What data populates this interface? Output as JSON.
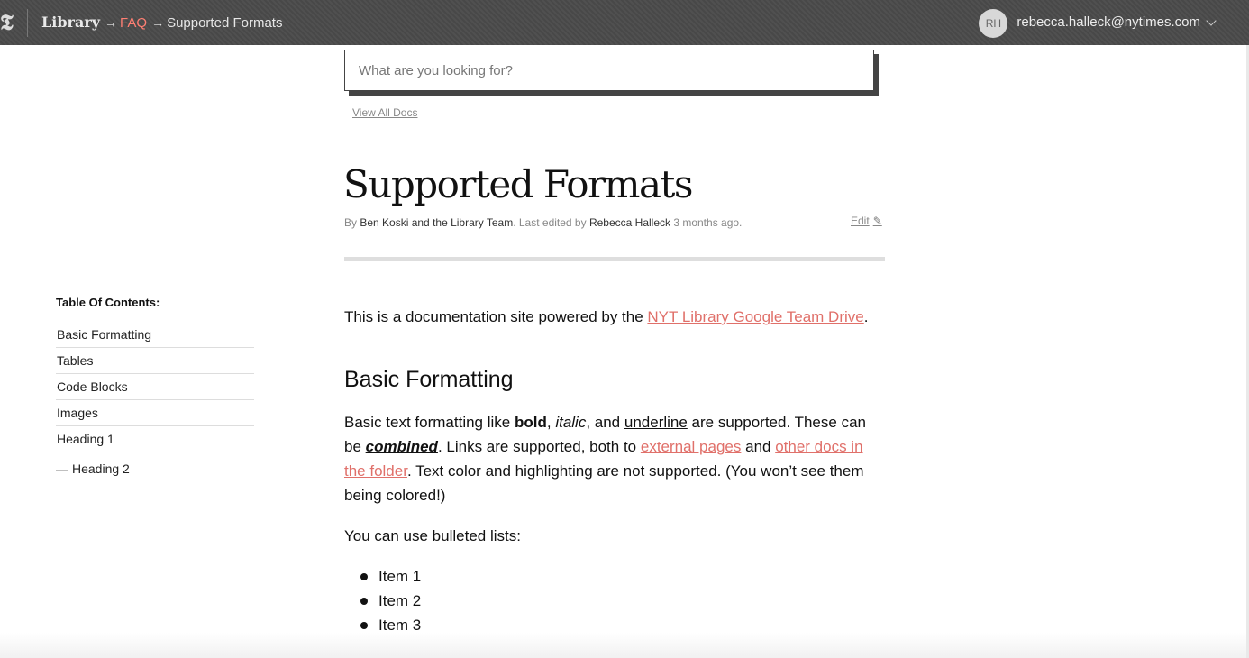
{
  "header": {
    "logo_glyph": "𝕿",
    "breadcrumb": {
      "home": "Library",
      "separator": "→",
      "faq": "FAQ",
      "current": "Supported Formats"
    },
    "user": {
      "initials": "RH",
      "email": "rebecca.halleck@nytimes.com"
    }
  },
  "search": {
    "placeholder": "What are you looking for?",
    "value": "",
    "view_all": "View All Docs"
  },
  "doc": {
    "title": "Supported Formats",
    "byline": {
      "by": "By ",
      "authors": "Ben Koski and the Library Team",
      "edited_prefix": ". Last edited by ",
      "editor": "Rebecca Halleck",
      "when": " 3 months ago."
    },
    "edit_label": "Edit"
  },
  "toc": {
    "heading": "Table Of Contents:",
    "items": [
      "Basic Formatting",
      "Tables",
      "Code Blocks",
      "Images",
      "Heading 1"
    ],
    "sub_dash": "—",
    "sub_item": "Heading 2"
  },
  "content": {
    "lead_prefix": "This is a documentation site powered by the ",
    "lead_link": "NYT Library Google Team Drive",
    "lead_suffix": ".",
    "section_heading": "Basic Formatting",
    "p2": {
      "t1": "Basic text formatting like ",
      "bold": "bold",
      "t2": ", ",
      "italic": "italic",
      "t3": ", and ",
      "underline": "underline",
      "t4": " are supported. These can be ",
      "combined": "combined",
      "t5": ". Links are supported, both to ",
      "link1": "external pages",
      "t6": " and ",
      "link2": "other docs in the folder",
      "t7": ". Text color and highlighting are not supported. (You won’t see them being colored!)"
    },
    "p3": "You can use bulleted lists:",
    "list": [
      "Item 1",
      "Item 2",
      "Item 3"
    ]
  }
}
